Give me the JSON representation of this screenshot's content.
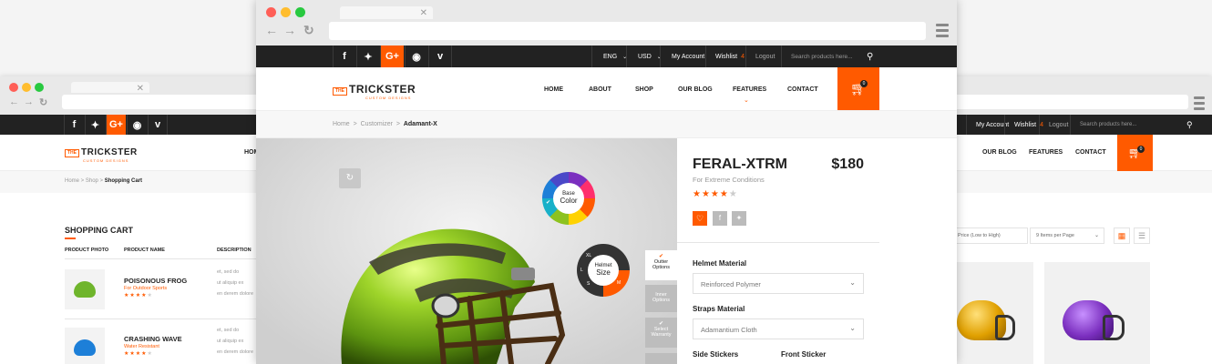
{
  "back_left": {
    "social": [
      "f",
      "t",
      "G+",
      "rss",
      "v"
    ],
    "topbar": {
      "account": "My Account",
      "wishlist": "Wishlist",
      "wishlist_count": "4",
      "logout": "Logout",
      "search_placeholder": "Search products here..."
    },
    "logo": {
      "the": "THE",
      "name": "TRICKSTER",
      "sub": "CUSTOM DESIGNS"
    },
    "menu": [
      "HOME",
      "OUR BLOG",
      "FEATURES",
      "CONTACT"
    ],
    "cart_count": "0",
    "breadcrumb": {
      "home": "Home",
      "shop": "Shop",
      "current": "Shopping Cart"
    },
    "cart_title": "SHOPPING CART",
    "columns": [
      "PRODUCT PHOTO",
      "PRODUCT NAME",
      "DESCRIPTION"
    ],
    "items": [
      {
        "name": "POISONOUS FROG",
        "subtitle": "For Outdoor Sports",
        "desc1": "et, sed do",
        "desc2": "ut aliquip ex",
        "desc3": "en derem dolore"
      },
      {
        "name": "CRASHING WAVE",
        "subtitle": "Water Resistant",
        "desc1": "et, sed do",
        "desc2": "ut aliquip ex",
        "desc3": "en derem dolore"
      }
    ],
    "sort_label": "Price (Low to High)",
    "per_page_label": "9 Items per Page"
  },
  "front": {
    "social": [
      "f",
      "t",
      "G+",
      "rss",
      "v"
    ],
    "topbar": {
      "lang": "ENG",
      "currency": "USD",
      "account": "My Account",
      "wishlist": "Wishlist",
      "wishlist_count": "4",
      "logout": "Logout",
      "search_placeholder": "Search products here..."
    },
    "logo": {
      "the": "THE",
      "name": "TRICKSTER",
      "sub": "CUSTOM DESIGNS"
    },
    "menu": [
      "HOME",
      "ABOUT",
      "SHOP",
      "OUR BLOG",
      "FEATURES",
      "CONTACT"
    ],
    "cart_count": "0",
    "breadcrumb": {
      "home": "Home",
      "customizer": "Customizer",
      "current": "Adamant-X"
    },
    "wheel_color": {
      "line1": "Base",
      "line2": "Color"
    },
    "wheel_size": {
      "line1": "Helmet",
      "line2": "Size",
      "opts": [
        "XL",
        "L",
        "S",
        "M"
      ]
    },
    "side_tabs": [
      {
        "l1": "Outter",
        "l2": "Options"
      },
      {
        "l1": "Inner",
        "l2": "Options"
      },
      {
        "l1": "Select",
        "l2": "Warranty"
      }
    ],
    "product": {
      "name": "FERAL-XTRM",
      "price": "$180",
      "subtitle": "For Extreme Conditions",
      "rating": 4,
      "rating_max": 5
    },
    "options": {
      "helmet_material_label": "Helmet Material",
      "helmet_material_value": "Reinforced Polymer",
      "straps_material_label": "Straps Material",
      "straps_material_value": "Adamantium Cloth",
      "side_stickers_label": "Side Stickers",
      "front_sticker_label": "Front Sticker"
    }
  },
  "colors": {
    "accent": "#ff5a00",
    "dark": "#222222",
    "helmet_green": "#8dc21f",
    "helmet_yellow": "#f0b400",
    "helmet_purple": "#7b2fbf",
    "helmet_blue": "#1d7fd8"
  }
}
